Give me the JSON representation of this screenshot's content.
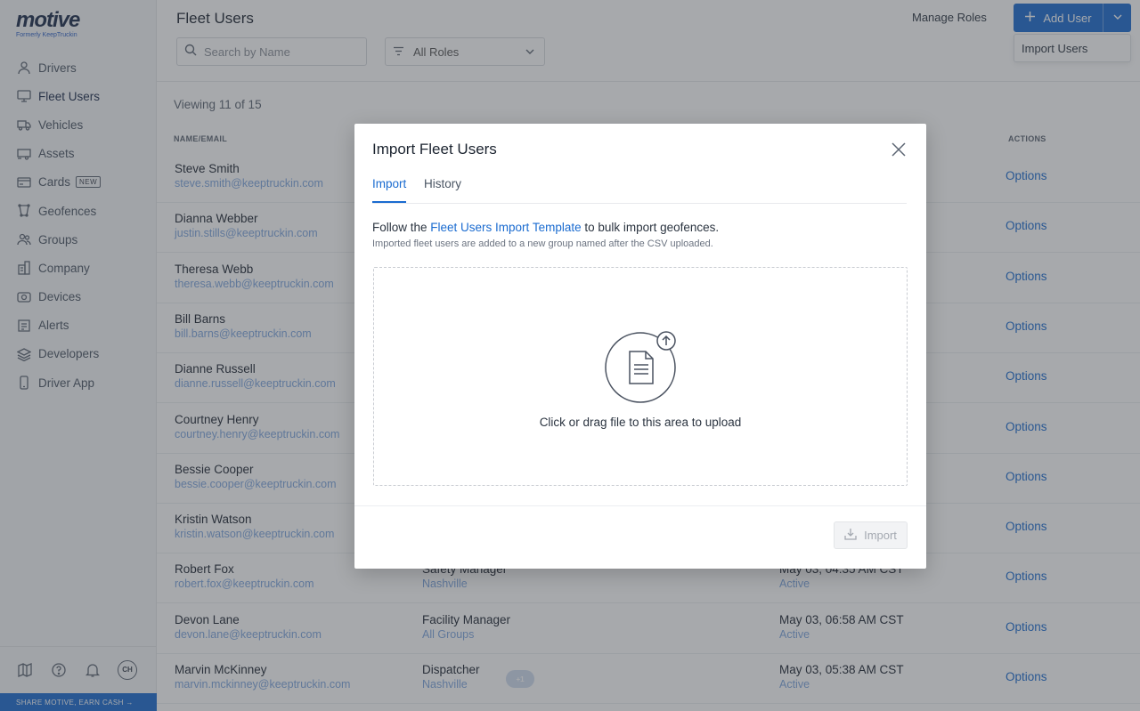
{
  "brand": {
    "name": "motive",
    "tagline": "Formerly KeepTruckin"
  },
  "sidebar": {
    "items": [
      {
        "label": "Drivers",
        "icon": "user-icon"
      },
      {
        "label": "Fleet Users",
        "icon": "monitor-icon",
        "active": true
      },
      {
        "label": "Vehicles",
        "icon": "truck-icon"
      },
      {
        "label": "Assets",
        "icon": "trailer-icon"
      },
      {
        "label": "Cards",
        "icon": "card-icon",
        "badge": "NEW"
      },
      {
        "label": "Geofences",
        "icon": "geofence-icon"
      },
      {
        "label": "Groups",
        "icon": "group-icon"
      },
      {
        "label": "Company",
        "icon": "building-icon"
      },
      {
        "label": "Devices",
        "icon": "device-icon"
      },
      {
        "label": "Alerts",
        "icon": "alert-icon"
      },
      {
        "label": "Developers",
        "icon": "layers-icon"
      },
      {
        "label": "Driver App",
        "icon": "phone-icon"
      }
    ],
    "avatar_initials": "CH",
    "promo": "SHARE MOTIVE, EARN CASH →"
  },
  "header": {
    "title": "Fleet Users",
    "search_placeholder": "Search by Name",
    "roles_filter": "All Roles",
    "manage_roles": "Manage Roles",
    "add_user": "Add User",
    "import_users": "Import Users"
  },
  "table": {
    "viewing": "Viewing 11 of 15",
    "headers": {
      "name": "NAME/EMAIL",
      "actions": "ACTIONS"
    },
    "rows": [
      {
        "name": "Steve Smith",
        "email": "steve.smith@keeptruckin.com",
        "role": "",
        "group": "",
        "date": "",
        "status": "",
        "action": "Options"
      },
      {
        "name": "Dianna Webber",
        "email": "justin.stills@keeptruckin.com",
        "role": "",
        "group": "",
        "date": "",
        "status": "",
        "action": "Options"
      },
      {
        "name": "Theresa Webb",
        "email": "theresa.webb@keeptruckin.com",
        "role": "",
        "group": "",
        "date": "",
        "status": "",
        "action": "Options"
      },
      {
        "name": "Bill Barns",
        "email": "bill.barns@keeptruckin.com",
        "role": "",
        "group": "",
        "date": "",
        "status": "",
        "action": "Options"
      },
      {
        "name": "Dianne Russell",
        "email": "dianne.russell@keeptruckin.com",
        "role": "",
        "group": "",
        "date": "",
        "status": "",
        "action": "Options"
      },
      {
        "name": "Courtney Henry",
        "email": "courtney.henry@keeptruckin.com",
        "role": "",
        "group": "",
        "date": "",
        "status": "",
        "action": "Options"
      },
      {
        "name": "Bessie Cooper",
        "email": "bessie.cooper@keeptruckin.com",
        "role": "",
        "group": "",
        "date": "",
        "status": "",
        "action": "Options"
      },
      {
        "name": "Kristin Watson",
        "email": "kristin.watson@keeptruckin.com",
        "role": "",
        "group": "",
        "date": "",
        "status": "",
        "action": "Options"
      },
      {
        "name": "Robert Fox",
        "email": "robert.fox@keeptruckin.com",
        "role": "Safety Manager",
        "group": "Nashville",
        "date": "May 03, 04:35 AM CST",
        "status": "Active",
        "action": "Options"
      },
      {
        "name": "Devon Lane",
        "email": "devon.lane@keeptruckin.com",
        "role": "Facility Manager",
        "group": "All Groups",
        "date": "May 03, 06:58 AM CST",
        "status": "Active",
        "action": "Options"
      },
      {
        "name": "Marvin McKinney",
        "email": "marvin.mckinney@keeptruckin.com",
        "role": "Dispatcher",
        "group": "Nashville",
        "date": "May 03, 05:38 AM CST",
        "status": "Active",
        "action": "Options",
        "extra_badge": "+1"
      }
    ]
  },
  "modal": {
    "title": "Import Fleet Users",
    "tabs": [
      {
        "label": "Import",
        "active": true
      },
      {
        "label": "History"
      }
    ],
    "help_prefix": "Follow the ",
    "help_link": "Fleet Users Import Template",
    "help_suffix": " to bulk import geofences.",
    "help_sub": "Imported fleet users are added to a new group named after the CSV uploaded.",
    "dropzone_text": "Click or drag file to this area to upload",
    "import_button": "Import"
  },
  "colors": {
    "accent": "#1a6bd0",
    "link_light": "#7fa6de",
    "overlay": "rgba(60,64,72,.45)"
  }
}
